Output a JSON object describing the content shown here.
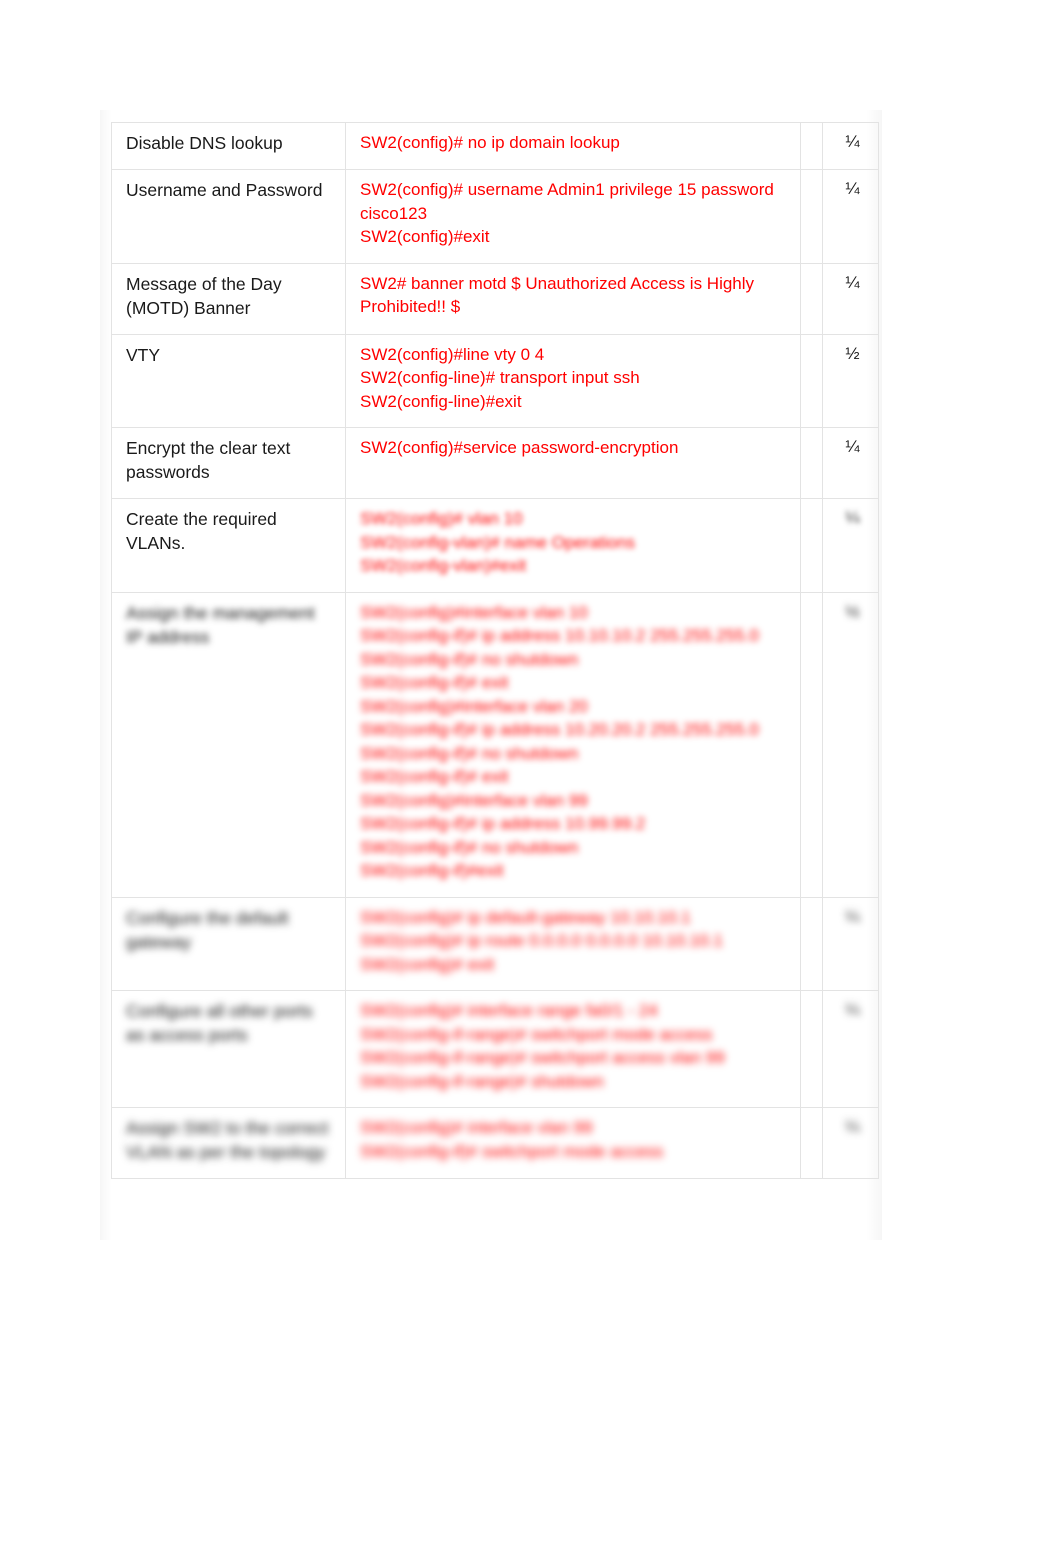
{
  "document": {
    "type": "scanned-worksheet-table",
    "text_color_primary": "#1a1a1a",
    "command_color": "#ff0000",
    "border_color": "#e3e3e3",
    "background": "#ffffff"
  },
  "table": {
    "rows": [
      {
        "task": "Disable DNS lookup",
        "command": "SW2(config)# no ip domain lookup",
        "score": "¼",
        "legible": true
      },
      {
        "task": "Username and Password",
        "command": "SW2(config)# username Admin1 privilege 15 password cisco123\nSW2(config)#exit",
        "score": "¼",
        "legible": true
      },
      {
        "task": "Message of the Day (MOTD) Banner",
        "command": "SW2# banner motd $ Unauthorized Access is Highly Prohibited!! $",
        "score": "¼",
        "legible": true
      },
      {
        "task": "VTY",
        "command": "SW2(config)#line vty 0 4\nSW2(config-line)# transport input ssh\nSW2(config-line)#exit",
        "score": "½",
        "legible": true
      },
      {
        "task": "Encrypt the clear text passwords",
        "command": "SW2(config)#service password-encryption",
        "score": "¼",
        "legible": true
      },
      {
        "task": "Create the required VLANs.",
        "command": "SW2(config)# vlan 10\nSW2(config-vlan)# name Operations\nSW2(config-vlan)#exit",
        "score": "¼",
        "legible": false,
        "blur": "blur-1"
      },
      {
        "task": "Assign the management IP address",
        "command": "SW2(config)#interface vlan 10\nSW2(config-if)# ip address 10.10.10.2 255.255.255.0\nSW2(config-if)# no shutdown\nSW2(config-if)# exit\nSW2(config)#interface vlan 20\nSW2(config-if)# ip address 10.20.20.2 255.255.255.0\nSW2(config-if)# no shutdown\nSW2(config-if)# exit\nSW2(config)#interface vlan 99\nSW2(config-if)# ip address 10.99.99.2\nSW2(config-if)# no shutdown\nSW2(config-if)#exit",
        "score": "½",
        "legible": false,
        "blur": "blur-2"
      },
      {
        "task": "Configure the default gateway",
        "command": "SW2(config)# ip default-gateway 10.10.10.1\nSW2(config)# ip route 0.0.0.0 0.0.0.0 10.10.10.1\nSW2(config)# exit",
        "score": "¼",
        "legible": false,
        "blur": "blur-3"
      },
      {
        "task": "Configure all other ports as access ports",
        "command": "SW2(config)# interface range fa0/1 - 24\nSW2(config-if-range)# switchport mode access\nSW2(config-if-range)# switchport access vlan 99\nSW2(config-if-range)# shutdown",
        "score": "¼",
        "legible": false,
        "blur": "blur-3"
      },
      {
        "task": "Assign SW2 to the correct VLAN as per the topology",
        "command": "SW2(config)# interface vlan 99\nSW2(config-if)# switchport mode access",
        "score": "¼",
        "legible": false,
        "blur": "blur-4"
      }
    ]
  }
}
